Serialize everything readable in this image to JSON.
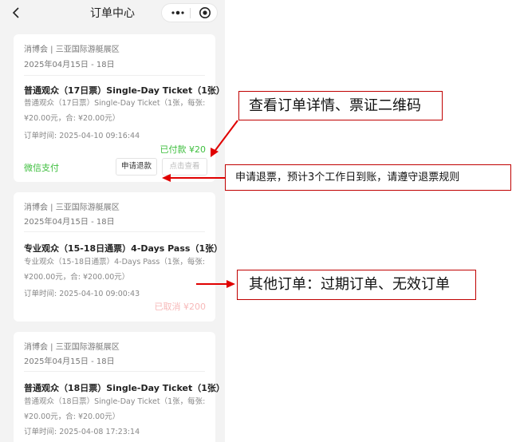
{
  "nav": {
    "title": "订单中心"
  },
  "orders": [
    {
      "expo": "消博会 | 三亚国际游艇展区",
      "date": "2025年04月15日 - 18日",
      "name": "普通观众（17日票）Single-Day Ticket（1张）",
      "detail": "普通观众（17日票）Single-Day Ticket（1张，每张:¥20.00元，合: ¥20.00元）",
      "time": "订单时间: 2025-04-10 09:16:44",
      "status": "已付款 ¥20",
      "pay_method": "微信支付",
      "refund_button": "申请退款",
      "view_button": "点击查看"
    },
    {
      "expo": "消博会 | 三亚国际游艇展区",
      "date": "2025年04月15日 - 18日",
      "name": "专业观众（15-18日通票）4-Days Pass（1张）",
      "detail": "专业观众（15-18日通票）4-Days Pass（1张，每张:¥200.00元，合: ¥200.00元）",
      "time": "订单时间: 2025-04-10 09:00:43",
      "status": "已取消 ¥200"
    },
    {
      "expo": "消博会 | 三亚国际游艇展区",
      "date": "2025年04月15日 - 18日",
      "name": "普通观众（18日票）Single-Day Ticket（1张）",
      "detail": "普通观众（18日票）Single-Day Ticket（1张，每张:¥20.00元，合: ¥20.00元）",
      "time": "订单时间: 2025-04-08 17:23:14"
    }
  ],
  "annotations": {
    "view_details": "查看订单详情、票证二维码",
    "refund_note": "申请退票，预计3个工作日到账，请遵守退票规则",
    "other_orders": "其他订单：过期订单、无效订单"
  },
  "colors": {
    "paid": "#3fbf3f",
    "cancelled": "#f7b9b9",
    "annotation": "#e00000"
  }
}
